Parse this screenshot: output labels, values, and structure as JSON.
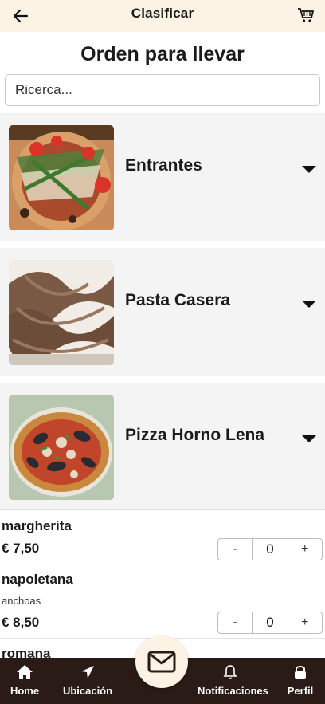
{
  "header": {
    "title": "Clasificar",
    "back_icon": "arrow-left-icon",
    "cart_icon": "cart-icon"
  },
  "page_title": "Orden para llevar",
  "search": {
    "placeholder": "Ricerca..."
  },
  "categories": [
    {
      "label": "Entrantes",
      "image": "salad-pizza-photo"
    },
    {
      "label": "Pasta Casera",
      "image": "pasta-photo"
    },
    {
      "label": "Pizza Horno Lena",
      "image": "seafood-pizza-photo"
    }
  ],
  "items": [
    {
      "name": "margherita",
      "desc": "",
      "price": "€ 7,50",
      "qty": "0"
    },
    {
      "name": "napoletana",
      "desc": "anchoas",
      "price": "€ 8,50",
      "qty": "0"
    },
    {
      "name": "romana"
    }
  ],
  "stepper": {
    "minus": "-",
    "plus": "+"
  },
  "nav": [
    {
      "label": "Home",
      "icon": "home-icon"
    },
    {
      "label": "Ubicación",
      "icon": "location-arrow-icon"
    },
    {
      "label": "Notificaciones",
      "icon": "bell-icon"
    },
    {
      "label": "Perfil",
      "icon": "lock-icon"
    }
  ],
  "fab": {
    "icon": "envelope-icon"
  },
  "colors": {
    "header_bg": "#fdf3e4",
    "nav_bg": "#2b1b16",
    "category_bg": "#f4f4f4"
  }
}
